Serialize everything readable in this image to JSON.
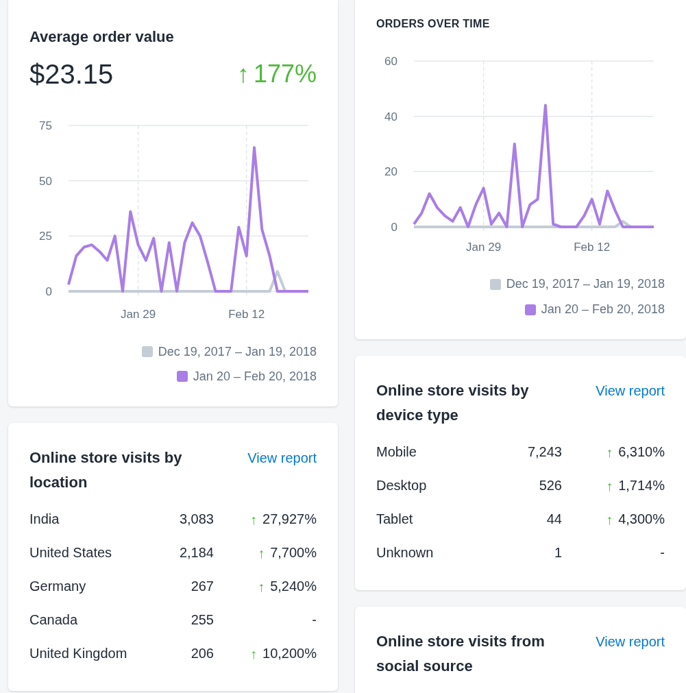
{
  "average_order_value": {
    "title": "Average order value",
    "value": "$23.15",
    "change": {
      "arrow": "↑",
      "text": "177%"
    },
    "chart_data": {
      "type": "line",
      "grid": true,
      "categories": [
        null,
        null,
        null,
        null,
        null,
        null,
        null,
        null,
        null,
        "Jan 29",
        null,
        null,
        null,
        null,
        null,
        null,
        null,
        null,
        null,
        null,
        null,
        null,
        null,
        "Feb 12",
        null,
        null,
        null,
        null,
        null,
        null,
        null,
        null
      ],
      "ylim": [
        0,
        75
      ],
      "yticks": [
        0,
        25,
        50,
        75
      ],
      "series": [
        {
          "name": "Dec 19, 2017 – Jan 19, 2018",
          "color": "#c4cdd5",
          "values": [
            0,
            0,
            0,
            0,
            0,
            0,
            0,
            0,
            0,
            0,
            0,
            0,
            0,
            0,
            0,
            0,
            0,
            0,
            0,
            0,
            0,
            0,
            0,
            0,
            0,
            0,
            0,
            9,
            0,
            0,
            null,
            null
          ]
        },
        {
          "name": "Jan 20 – Feb 20, 2018",
          "color": "#a97ee6",
          "values": [
            3,
            16,
            20,
            21,
            18,
            14,
            25,
            0,
            36,
            21,
            14,
            24,
            0,
            22,
            0,
            22,
            31,
            25,
            13,
            0,
            0,
            0,
            29,
            16,
            65,
            28,
            16,
            0,
            0,
            0,
            0,
            0
          ]
        }
      ]
    }
  },
  "orders_over_time": {
    "title": "ORDERS OVER TIME",
    "chart_data": {
      "type": "line",
      "grid": true,
      "categories": [
        null,
        null,
        null,
        null,
        null,
        null,
        null,
        null,
        null,
        "Jan 29",
        null,
        null,
        null,
        null,
        null,
        null,
        null,
        null,
        null,
        null,
        null,
        null,
        null,
        "Feb 12",
        null,
        null,
        null,
        null,
        null,
        null,
        null,
        null
      ],
      "ylim": [
        0,
        60
      ],
      "yticks": [
        0,
        20,
        40,
        60
      ],
      "series": [
        {
          "name": "Dec 19, 2017 – Jan 19, 2018",
          "color": "#c4cdd5",
          "values": [
            0,
            0,
            0,
            0,
            0,
            0,
            0,
            0,
            0,
            0,
            0,
            0,
            0,
            0,
            0,
            0,
            0,
            0,
            0,
            0,
            0,
            0,
            0,
            0,
            0,
            0,
            0,
            2,
            0,
            0,
            null,
            null
          ]
        },
        {
          "name": "Jan 20 – Feb 20, 2018",
          "color": "#a97ee6",
          "values": [
            1,
            5,
            12,
            7,
            4,
            2,
            7,
            0,
            8,
            14,
            1,
            5,
            0,
            30,
            0,
            8,
            10,
            44,
            1,
            0,
            0,
            0,
            4,
            10,
            1,
            13,
            6,
            0,
            0,
            0,
            0,
            0
          ]
        }
      ]
    }
  },
  "visits_by_location": {
    "title": "Online store visits by location",
    "link": "View report",
    "rows": [
      {
        "name": "India",
        "visits": "3,083",
        "arrow": "↑",
        "change": "27,927%"
      },
      {
        "name": "United States",
        "visits": "2,184",
        "arrow": "↑",
        "change": "7,700%"
      },
      {
        "name": "Germany",
        "visits": "267",
        "arrow": "↑",
        "change": "5,240%"
      },
      {
        "name": "Canada",
        "visits": "255",
        "change": "-"
      },
      {
        "name": "United Kingdom",
        "visits": "206",
        "arrow": "↑",
        "change": "10,200%"
      }
    ]
  },
  "visits_by_device": {
    "title": "Online store visits by device type",
    "link": "View report",
    "rows": [
      {
        "name": "Mobile",
        "visits": "7,243",
        "arrow": "↑",
        "change": "6,310%"
      },
      {
        "name": "Desktop",
        "visits": "526",
        "arrow": "↑",
        "change": "1,714%"
      },
      {
        "name": "Tablet",
        "visits": "44",
        "arrow": "↑",
        "change": "4,300%"
      },
      {
        "name": "Unknown",
        "visits": "1",
        "change": "-"
      }
    ]
  },
  "visits_by_social": {
    "title": "Online store visits from social source",
    "link": "View report"
  }
}
